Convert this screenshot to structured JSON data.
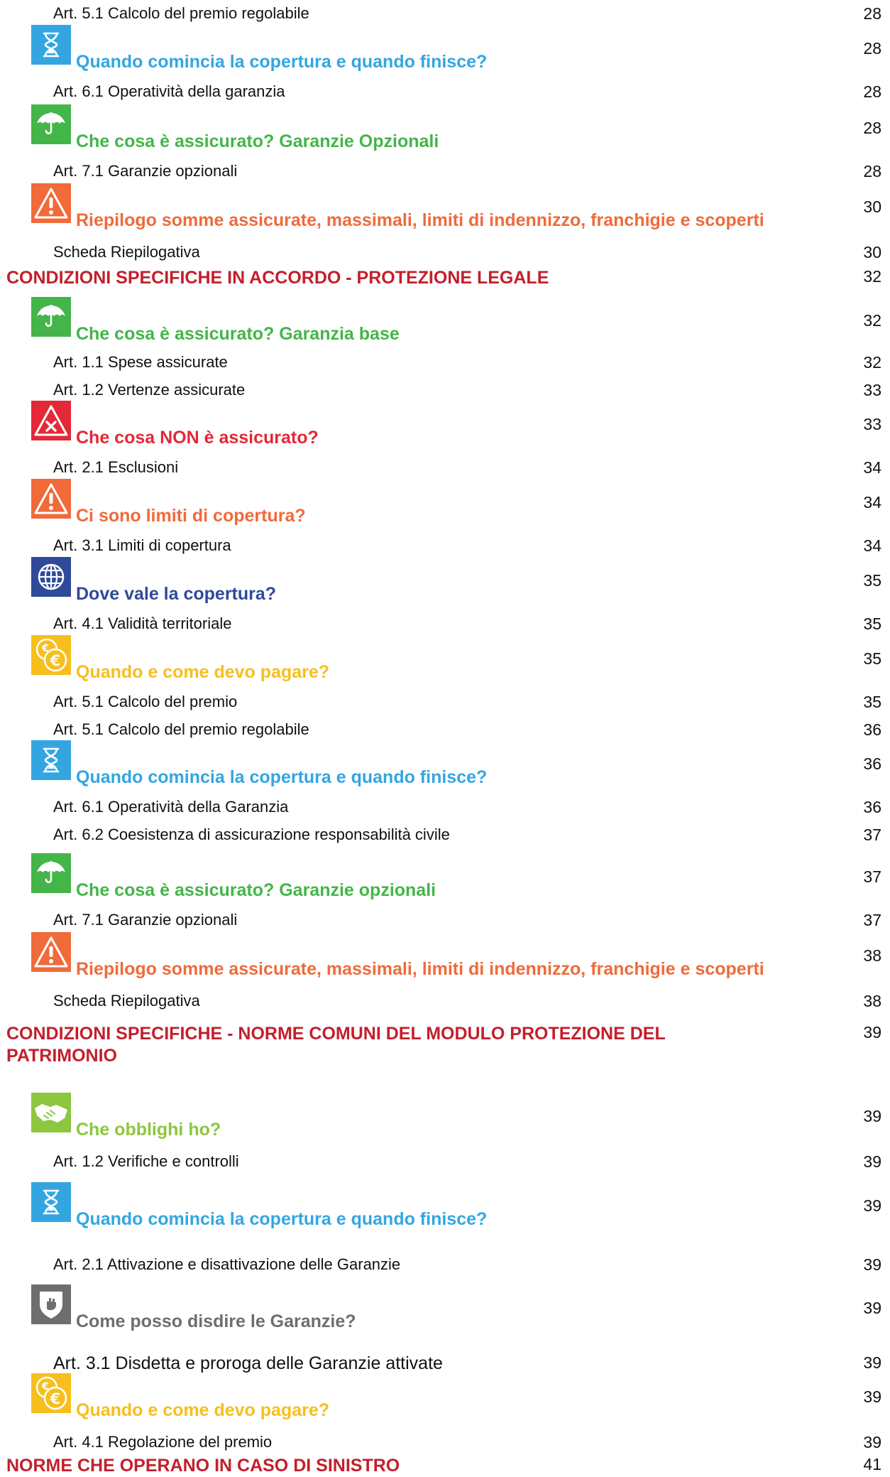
{
  "colors": {
    "chapter": "#c31f2c",
    "hourglass": "#33a6e2",
    "umbrella": "#44b549",
    "warning": "#f06a3a",
    "exclusion": "#e32838",
    "globe": "#2f4a9a",
    "coins": "#f7bf1e",
    "handshake": "#8dc63f",
    "shield": "#6d6e70"
  },
  "entries": [
    {
      "kind": "art",
      "text": "Art. 5.1 Calcolo del premio regolabile",
      "page": "28"
    },
    {
      "kind": "sec",
      "icon": "hourglass",
      "text": "Quando comincia la copertura e quando finisce?",
      "page": "28"
    },
    {
      "kind": "art",
      "text": "Art. 6.1 Operatività della garanzia",
      "page": "28"
    },
    {
      "kind": "sec",
      "icon": "umbrella",
      "text": "Che cosa è assicurato? Garanzie Opzionali",
      "page": "28"
    },
    {
      "kind": "art",
      "text": "Art. 7.1 Garanzie opzionali",
      "page": "28"
    },
    {
      "kind": "sec",
      "icon": "warning",
      "text": "Riepilogo somme assicurate, massimali, limiti di indennizzo, franchigie e scoperti",
      "page": "30"
    },
    {
      "kind": "art",
      "text": "Scheda Riepilogativa",
      "page": "30"
    },
    {
      "kind": "chapter",
      "text": "CONDIZIONI SPECIFICHE IN ACCORDO - PROTEZIONE LEGALE",
      "page": "32"
    },
    {
      "kind": "sec",
      "icon": "umbrella",
      "text": "Che cosa è assicurato? Garanzia base",
      "page": "32"
    },
    {
      "kind": "art",
      "text": "Art. 1.1 Spese assicurate",
      "page": "32"
    },
    {
      "kind": "art",
      "text": "Art. 1.2 Vertenze assicurate",
      "page": "33"
    },
    {
      "kind": "sec",
      "icon": "exclusion",
      "text": "Che cosa NON è assicurato?",
      "page": "33"
    },
    {
      "kind": "art",
      "text": "Art. 2.1 Esclusioni",
      "page": "34"
    },
    {
      "kind": "sec",
      "icon": "warning",
      "text": "Ci sono limiti di copertura?",
      "page": "34"
    },
    {
      "kind": "art",
      "text": "Art. 3.1 Limiti di copertura",
      "page": "34"
    },
    {
      "kind": "sec",
      "icon": "globe",
      "text": "Dove vale la copertura?",
      "page": "35"
    },
    {
      "kind": "art",
      "text": "Art. 4.1 Validità territoriale",
      "page": "35"
    },
    {
      "kind": "sec",
      "icon": "coins",
      "text": "Quando e come devo pagare?",
      "page": "35"
    },
    {
      "kind": "art",
      "text": "Art. 5.1 Calcolo del premio",
      "page": "35"
    },
    {
      "kind": "art",
      "text": "Art. 5.1 Calcolo del premio regolabile",
      "page": "36"
    },
    {
      "kind": "sec",
      "icon": "hourglass",
      "text": "Quando comincia la copertura e quando finisce?",
      "page": "36"
    },
    {
      "kind": "art",
      "text": "Art. 6.1 Operatività della Garanzia",
      "page": "36"
    },
    {
      "kind": "art",
      "text": "Art. 6.2 Coesistenza di assicurazione responsabilità civile",
      "page": "37"
    },
    {
      "kind": "sec",
      "icon": "umbrella",
      "text": "Che cosa è assicurato? Garanzie opzionali",
      "page": "37"
    },
    {
      "kind": "art",
      "text": "Art. 7.1 Garanzie opzionali",
      "page": "37"
    },
    {
      "kind": "sec",
      "icon": "warning",
      "text": "Riepilogo somme assicurate, massimali, limiti di indennizzo, franchigie e scoperti",
      "page": "38"
    },
    {
      "kind": "art",
      "text": "Scheda Riepilogativa",
      "page": "38"
    },
    {
      "kind": "chapter",
      "text": "CONDIZIONI SPECIFICHE - NORME COMUNI DEL MODULO PROTEZIONE DEL PATRIMONIO",
      "page": "39"
    },
    {
      "kind": "sec",
      "icon": "handshake",
      "text": "Che obblighi ho?",
      "page": "39"
    },
    {
      "kind": "art",
      "text": "Art. 1.2 Verifiche e controlli",
      "page": "39"
    },
    {
      "kind": "sec",
      "icon": "hourglass",
      "text": "Quando comincia la copertura e quando finisce?",
      "page": "39"
    },
    {
      "kind": "art",
      "text": "Art. 2.1 Attivazione e disattivazione delle Garanzie",
      "page": "39"
    },
    {
      "kind": "sec",
      "icon": "shield",
      "text": "Come posso disdire le Garanzie?",
      "page": "39"
    },
    {
      "kind": "art",
      "text": "Art. 3.1 Disdetta e proroga delle Garanzie attivate",
      "page": "39"
    },
    {
      "kind": "sec",
      "icon": "coins",
      "text": "Quando e come devo pagare?",
      "page": "39"
    },
    {
      "kind": "art",
      "text": "Art. 4.1 Regolazione del premio",
      "page": "39"
    },
    {
      "kind": "chapter",
      "text": "NORME CHE OPERANO IN CASO DI SINISTRO",
      "page": "41"
    }
  ]
}
